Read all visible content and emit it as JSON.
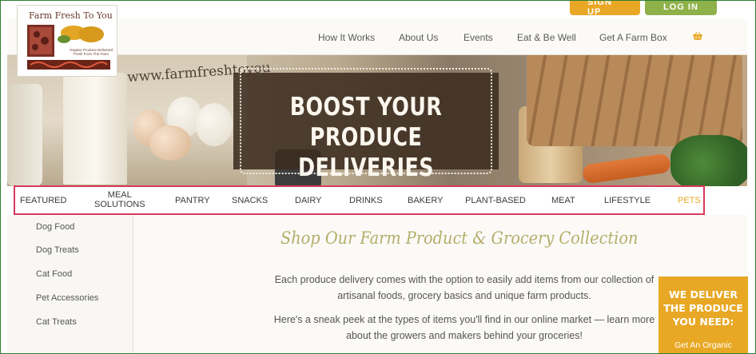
{
  "utility": {
    "signup_label": "SIGN UP",
    "login_label": "LOG IN"
  },
  "logo": {
    "name": "Farm Fresh To You",
    "tagline": "Organic Produce Delivered Fresh From The Farm"
  },
  "nav": {
    "items": [
      "How It Works",
      "About Us",
      "Events",
      "Eat & Be Well",
      "Get A Farm Box"
    ],
    "cart_icon": "basket-icon"
  },
  "hero": {
    "url_text": "www.farmfreshtoyou",
    "title_line1": "BOOST YOUR",
    "title_line2": "PRODUCE DELIVERIES"
  },
  "categories": {
    "items": [
      "FEATURED",
      "MEAL SOLUTIONS",
      "PANTRY",
      "SNACKS",
      "DAIRY",
      "DRINKS",
      "BAKERY",
      "PLANT-BASED",
      "MEAT",
      "LIFESTYLE",
      "PETS"
    ],
    "meal_line1": "MEAL",
    "meal_line2": "SOLUTIONS",
    "active": "PETS",
    "active_color": "#e8a825",
    "highlight_color": "#d63a5a"
  },
  "sidebar": {
    "items": [
      "Dog Food",
      "Dog Treats",
      "Cat Food",
      "Pet Accessories",
      "Cat Treats"
    ]
  },
  "main": {
    "heading": "Shop Our Farm Product & Grocery Collection",
    "para1_line1": "Each produce delivery comes with the option to easily add items from our collection of",
    "para1_line2": "artisanal foods, grocery basics and unique farm products.",
    "para2_line1": "Here's a sneak peek at the types of items you'll find in our online market — learn more",
    "para2_line2": "about the growers and makers behind your groceries!"
  },
  "promo": {
    "line1": "WE DELIVER",
    "line2": "THE PRODUCE",
    "line3": "YOU NEED:",
    "sub": "Get An Organic",
    "color": "#e8a825"
  }
}
